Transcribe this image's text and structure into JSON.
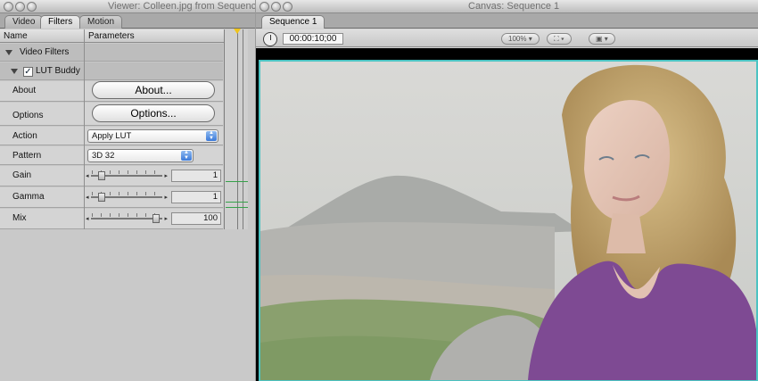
{
  "viewer": {
    "title": "Viewer: Colleen.jpg from Sequence",
    "tabs": [
      {
        "label": "Video"
      },
      {
        "label": "Filters"
      },
      {
        "label": "Motion"
      }
    ],
    "columns": {
      "name": "Name",
      "parameters": "Parameters"
    },
    "group_label": "Video Filters",
    "filter_name": "LUT Buddy",
    "filter_enabled": true,
    "about_label": "About",
    "about_button": "About...",
    "options_label": "Options",
    "options_button": "Options...",
    "action_label": "Action",
    "action_value": "Apply LUT",
    "pattern_label": "Pattern",
    "pattern_value": "3D 32",
    "sliders": [
      {
        "label": "Gain",
        "value": "1",
        "level": 0.1
      },
      {
        "label": "Gamma",
        "value": "1",
        "level": 0.1
      },
      {
        "label": "Mix",
        "value": "100",
        "level": 1.0
      }
    ]
  },
  "canvas": {
    "title": "Canvas: Sequence 1",
    "tab": "Sequence 1",
    "timecode": "00:00:10;00",
    "zoom": "100%"
  }
}
